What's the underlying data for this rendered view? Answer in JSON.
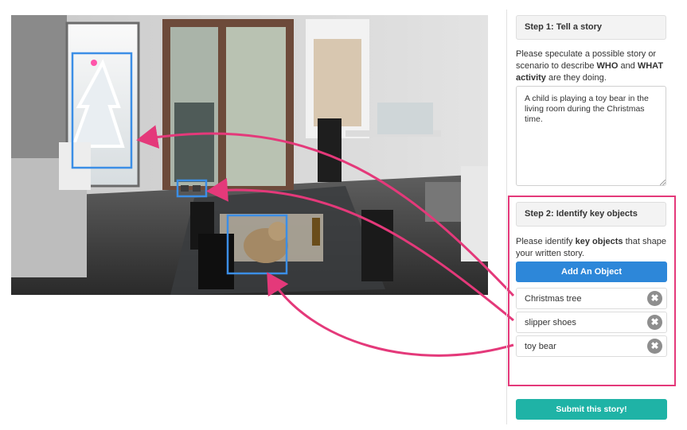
{
  "scene": {
    "image_alt": "Living room with Christmas tree decoration, slipper shoes, and toy bear on dining table"
  },
  "annotations": [
    {
      "label": "Christmas tree",
      "color": "#3b8ee6"
    },
    {
      "label": "slipper shoes",
      "color": "#3b8ee6"
    },
    {
      "label": "toy bear",
      "color": "#3b8ee6"
    }
  ],
  "step1": {
    "title": "Step 1: Tell a story",
    "prompt_parts": [
      "Please speculate a possible story or scenario to describe ",
      "WHO",
      " and ",
      "WHAT activity",
      " are they doing."
    ],
    "story_text": "A child is playing a toy bear in the living room during the Christmas time."
  },
  "step2": {
    "title": "Step 2: Identify key objects",
    "prompt_parts": [
      "Please identify ",
      "key objects",
      " that shape your written story."
    ],
    "add_label": "Add An Object",
    "objects": [
      {
        "label": "Christmas tree"
      },
      {
        "label": "slipper shoes"
      },
      {
        "label": "toy bear"
      }
    ],
    "remove_glyph": "✖"
  },
  "submit_label": "Submit this story!",
  "colors": {
    "accent_blue": "#2d87d9",
    "submit_teal": "#1fb3a6",
    "highlight_pink": "#e4397a",
    "bbox_blue": "#3b8ee6"
  },
  "icons": {
    "remove": "close-circle-icon",
    "resize": "resize-grip-icon"
  }
}
